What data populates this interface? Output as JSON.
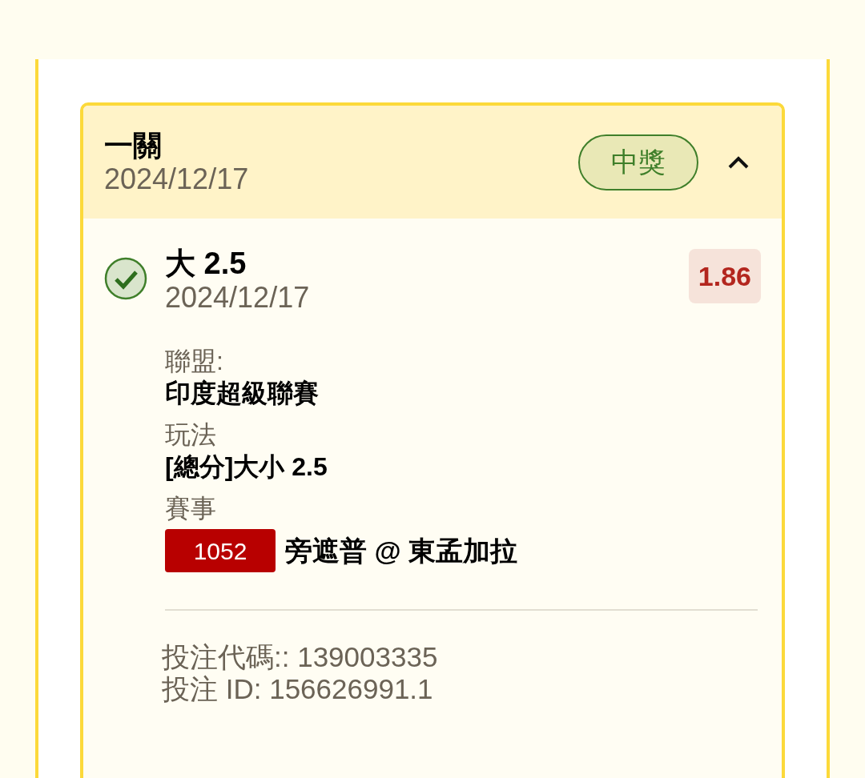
{
  "bet": {
    "title": "一關",
    "date": "2024/12/17",
    "status": {
      "kind": "won",
      "label": "中獎"
    },
    "expanded": true
  },
  "selection": {
    "won": true,
    "pick": "大 2.5",
    "date": "2024/12/17",
    "odds": "1.86",
    "league": {
      "label": "聯盟:",
      "value": "印度超級聯賽"
    },
    "market": {
      "label": "玩法",
      "value": "[總分]大小 2.5"
    },
    "match": {
      "label": "賽事",
      "code": "1052",
      "teams": "旁遮普 @ 東孟加拉"
    }
  },
  "footer": [
    "投注代碼:: 139003335",
    "投注 ID: 156626991.1"
  ]
}
